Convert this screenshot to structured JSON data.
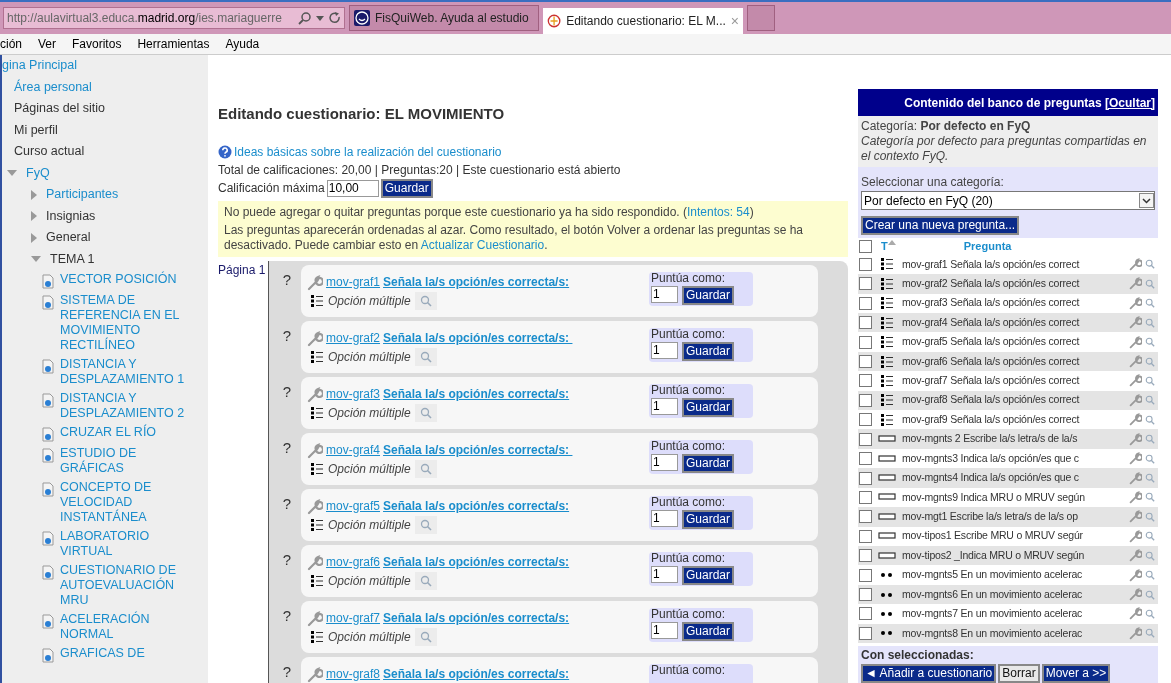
{
  "browser": {
    "address": {
      "prefix": "http://aulavirtual3.educa.",
      "domain": "madrid.org",
      "path": "/ies.mariaguerre"
    },
    "tabs": [
      {
        "title": "FisQuiWeb. Ayuda al estudio",
        "selected": false
      },
      {
        "title": "Editando cuestionario: EL M...",
        "selected": true,
        "close": "×"
      }
    ],
    "menu": [
      "ción",
      "Ver",
      "Favoritos",
      "Herramientas",
      "Ayuda"
    ]
  },
  "sidebar": {
    "items": [
      {
        "label": "gina Principal",
        "kind": "link"
      },
      {
        "label": "Área personal",
        "kind": "link"
      },
      {
        "label": "Páginas del sitio",
        "kind": "text"
      },
      {
        "label": "Mi perfil",
        "kind": "text"
      },
      {
        "label": "Curso actual",
        "kind": "text"
      },
      {
        "label": "FyQ",
        "kind": "node",
        "link": true,
        "expanded": true,
        "children": [
          {
            "label": "Participantes",
            "kind": "node",
            "link": true,
            "expanded": false
          },
          {
            "label": "Insignias",
            "kind": "node",
            "link": false,
            "expanded": false
          },
          {
            "label": "General",
            "kind": "node",
            "link": false,
            "expanded": false
          },
          {
            "label": "TEMA 1",
            "kind": "node",
            "link": false,
            "expanded": true,
            "children": [
              {
                "label": "VECTOR POSICIÓN",
                "kind": "page"
              },
              {
                "label": "SISTEMA DE REFERENCIA EN EL MOVIMIENTO RECTILÍNEO",
                "kind": "page"
              },
              {
                "label": "DISTANCIA Y DESPLAZAMIENTO 1",
                "kind": "page"
              },
              {
                "label": "DISTANCIA Y DESPLAZAMIENTO 2",
                "kind": "page"
              },
              {
                "label": "CRUZAR EL RÍO",
                "kind": "page"
              },
              {
                "label": "ESTUDIO DE GRÁFICAS",
                "kind": "page"
              },
              {
                "label": "CONCEPTO DE VELOCIDAD INSTANTÁNEA",
                "kind": "page"
              },
              {
                "label": "LABORATORIO VIRTUAL",
                "kind": "page"
              },
              {
                "label": "CUESTIONARIO DE AUTOEVALUACIÓN MRU",
                "kind": "page"
              },
              {
                "label": "ACELERACIÓN NORMAL",
                "kind": "page"
              },
              {
                "label": "GRAFICAS DE",
                "kind": "page"
              }
            ]
          }
        ]
      }
    ]
  },
  "main": {
    "title": "Editando cuestionario: EL MOVIMIENTO",
    "help_link": "Ideas básicas sobre la realización del cuestionario",
    "summary": "Total de calificaciones: 20,00 | Preguntas:20 | Este cuestionario está abierto",
    "max_grade": {
      "label": "Calificación máxima",
      "value": "10,00",
      "button": "Guardar"
    },
    "notice": {
      "line1": "No puede agregar o quitar preguntas porque este cuestionario ya ha sido respondido. (",
      "attempts": "Intentos: 54",
      "line1_end": ")",
      "line2": "Las preguntas aparecerán ordenadas al azar. Como resultado, el botón Volver a ordenar las preguntas se ha desactivado. Puede cambiar esto en ",
      "link": "Actualizar Cuestionario",
      "line2_end": "."
    },
    "page_label": "Página 1",
    "questions": [
      {
        "mark": "?",
        "name": "mov-graf1",
        "text": "Señala la/s opción/es correcta/s:",
        "type": "Opción múltiple",
        "score_label": "Puntúa como:",
        "score": "1",
        "button": "Guardar"
      },
      {
        "mark": "?",
        "name": "mov-graf2",
        "text": "Señala la/s opción/es correcta/s: ",
        "type": "Opción múltiple",
        "score_label": "Puntúa como:",
        "score": "1",
        "button": "Guardar"
      },
      {
        "mark": "?",
        "name": "mov-graf3",
        "text": "Señala la/s opción/es correcta/s:",
        "type": "Opción múltiple",
        "score_label": "Puntúa como:",
        "score": "1",
        "button": "Guardar"
      },
      {
        "mark": "?",
        "name": "mov-graf4",
        "text": "Señala la/s opción/es correcta/s: ",
        "type": "Opción múltiple",
        "score_label": "Puntúa como:",
        "score": "1",
        "button": "Guardar"
      },
      {
        "mark": "?",
        "name": "mov-graf5",
        "text": "Señala la/s opción/es correcta/s:",
        "type": "Opción múltiple",
        "score_label": "Puntúa como:",
        "score": "1",
        "button": "Guardar"
      },
      {
        "mark": "?",
        "name": "mov-graf6",
        "text": "Señala la/s opción/es correcta/s:",
        "type": "Opción múltiple",
        "score_label": "Puntúa como:",
        "score": "1",
        "button": "Guardar"
      },
      {
        "mark": "?",
        "name": "mov-graf7",
        "text": "Señala la/s opción/es correcta/s:",
        "type": "Opción múltiple",
        "score_label": "Puntúa como:",
        "score": "1",
        "button": "Guardar"
      },
      {
        "mark": "?",
        "name": "mov-graf8",
        "text": "Señala la/s opción/es correcta/s:",
        "score_label": "Puntúa como:"
      }
    ]
  },
  "bank": {
    "title": "Contenido del banco de preguntas ",
    "hide_link": "[Ocultar]",
    "category_label": "Categoría: ",
    "category": "Por defecto en FyQ",
    "category_desc": "Categoría por defecto para preguntas compartidas en el contexto FyQ.",
    "select_label": "Seleccionar una categoría:",
    "select_value": "Por defecto en FyQ (20)",
    "create_button": "Crear una nueva pregunta...",
    "select_all_checked": false,
    "columns": {
      "type": "T",
      "question": "Pregunta"
    },
    "rows": [
      {
        "kind": "multichoice",
        "text": "mov-graf1 Señala la/s opción/es correct",
        "checked": false
      },
      {
        "kind": "multichoice",
        "text": "mov-graf2 Señala la/s opción/es correct",
        "checked": false
      },
      {
        "kind": "multichoice",
        "text": "mov-graf3 Señala la/s opción/es correct",
        "checked": false
      },
      {
        "kind": "multichoice",
        "text": "mov-graf4 Señala la/s opción/es correct",
        "checked": false
      },
      {
        "kind": "multichoice",
        "text": "mov-graf5 Señala la/s opción/es correct",
        "checked": false
      },
      {
        "kind": "multichoice",
        "text": "mov-graf6 Señala la/s opción/es correct",
        "checked": false
      },
      {
        "kind": "multichoice",
        "text": "mov-graf7 Señala la/s opción/es correct",
        "checked": false
      },
      {
        "kind": "multichoice",
        "text": "mov-graf8 Señala la/s opción/es correct",
        "checked": false
      },
      {
        "kind": "multichoice",
        "text": "mov-graf9 Señala la/s opción/es correct",
        "checked": false
      },
      {
        "kind": "shortanswer",
        "text": "mov-mgnts 2 Escribe la/s letra/s de la/s",
        "checked": false
      },
      {
        "kind": "shortanswer",
        "text": "mov-mgnts3 Indica la/s opción/es que c",
        "checked": false
      },
      {
        "kind": "shortanswer",
        "text": "mov-mgnts4 Indica la/s opción/es que c",
        "checked": false
      },
      {
        "kind": "shortanswer",
        "text": "mov-mgnts9 Indica MRU o MRUV según",
        "checked": false
      },
      {
        "kind": "shortanswer",
        "text": "mov-mgt1 Escribe la/s letra/s de la/s op",
        "checked": false
      },
      {
        "kind": "shortanswer",
        "text": "mov-tipos1 Escribe MRU o MRUV segúr",
        "checked": false
      },
      {
        "kind": "shortanswer",
        "text": "mov-tipos2 _Indica MRU o MRUV según",
        "checked": false
      },
      {
        "kind": "matching",
        "text": "mov-mgnts5 En un movimiento acelerac",
        "checked": false
      },
      {
        "kind": "matching",
        "text": "mov-mgnts6 En un movimiento acelerac",
        "checked": false
      },
      {
        "kind": "matching",
        "text": "mov-mgnts7 En un movimiento acelerac",
        "checked": false
      },
      {
        "kind": "matching",
        "text": "mov-mgnts8 En un movimiento acelerac",
        "checked": false
      }
    ],
    "with_selected": "Con seleccionadas:",
    "actions": [
      {
        "label": "Añadir a cuestionario",
        "arrow": "◄"
      },
      {
        "label": "Borrar"
      },
      {
        "label": "Mover a >>"
      }
    ]
  }
}
